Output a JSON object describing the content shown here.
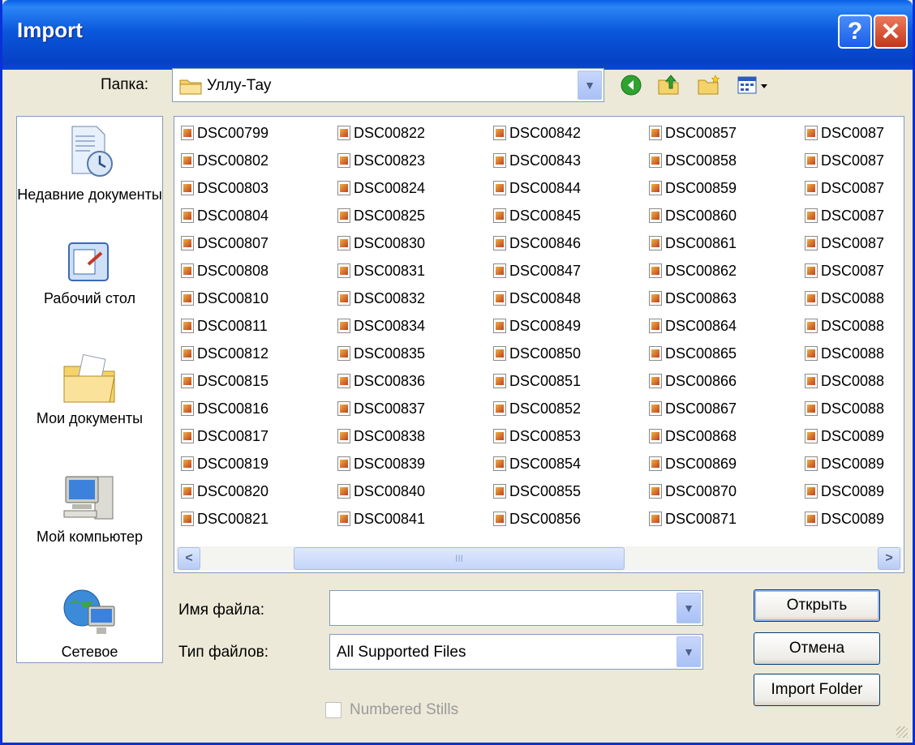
{
  "window": {
    "title": "Import"
  },
  "toolbar": {
    "folder_label": "Папка:",
    "folder_value": "Уллу-Тау",
    "icons": [
      "back-icon",
      "up-folder-icon",
      "new-folder-icon",
      "view-menu-icon"
    ]
  },
  "places": [
    {
      "name": "recent",
      "label": "Недавние документы"
    },
    {
      "name": "desktop",
      "label": "Рабочий стол"
    },
    {
      "name": "my-documents",
      "label": "Мои документы"
    },
    {
      "name": "my-computer",
      "label": "Мой компьютер"
    },
    {
      "name": "network",
      "label": "Сетевое"
    }
  ],
  "files": [
    [
      "DSC00799",
      "DSC00802",
      "DSC00803",
      "DSC00804",
      "DSC00807",
      "DSC00808",
      "DSC00810",
      "DSC00811",
      "DSC00812",
      "DSC00815",
      "DSC00816",
      "DSC00817",
      "DSC00819",
      "DSC00820",
      "DSC00821"
    ],
    [
      "DSC00822",
      "DSC00823",
      "DSC00824",
      "DSC00825",
      "DSC00830",
      "DSC00831",
      "DSC00832",
      "DSC00834",
      "DSC00835",
      "DSC00836",
      "DSC00837",
      "DSC00838",
      "DSC00839",
      "DSC00840",
      "DSC00841"
    ],
    [
      "DSC00842",
      "DSC00843",
      "DSC00844",
      "DSC00845",
      "DSC00846",
      "DSC00847",
      "DSC00848",
      "DSC00849",
      "DSC00850",
      "DSC00851",
      "DSC00852",
      "DSC00853",
      "DSC00854",
      "DSC00855",
      "DSC00856"
    ],
    [
      "DSC00857",
      "DSC00858",
      "DSC00859",
      "DSC00860",
      "DSC00861",
      "DSC00862",
      "DSC00863",
      "DSC00864",
      "DSC00865",
      "DSC00866",
      "DSC00867",
      "DSC00868",
      "DSC00869",
      "DSC00870",
      "DSC00871"
    ],
    [
      "DSC0087",
      "DSC0087",
      "DSC0087",
      "DSC0087",
      "DSC0087",
      "DSC0087",
      "DSC0088",
      "DSC0088",
      "DSC0088",
      "DSC0088",
      "DSC0088",
      "DSC0089",
      "DSC0089",
      "DSC0089",
      "DSC0089"
    ]
  ],
  "filename": {
    "label": "Имя файла:",
    "value": ""
  },
  "filetype": {
    "label": "Тип файлов:",
    "value": "All Supported Files"
  },
  "buttons": {
    "open": "Открыть",
    "cancel": "Отмена",
    "import_folder": "Import Folder"
  },
  "numbered_stills": {
    "label": "Numbered Stills",
    "checked": false,
    "enabled": false
  },
  "scrollbar": {
    "thumb_grip": "III"
  }
}
